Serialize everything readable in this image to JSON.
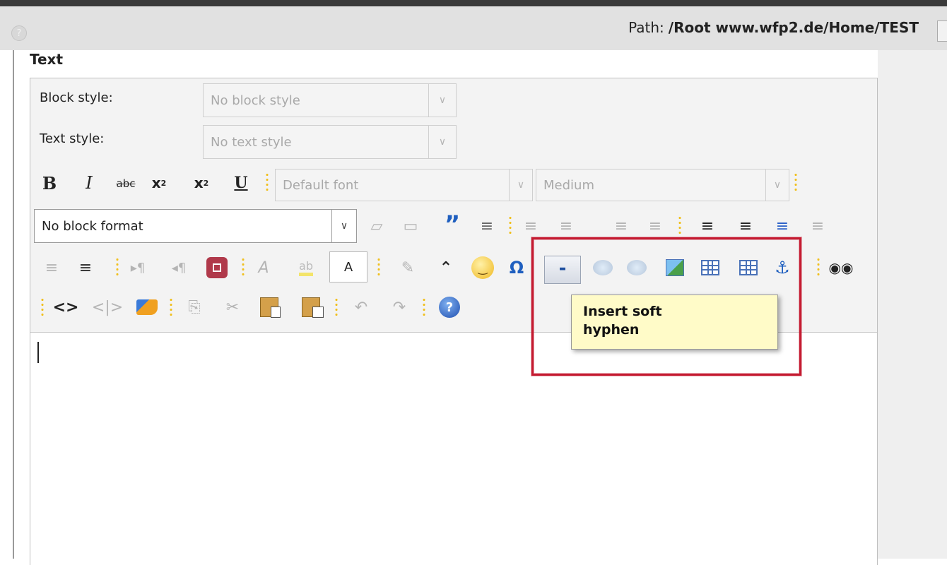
{
  "path": {
    "label": "Path:",
    "value": "/Root www.wfp2.de/Home/TEST"
  },
  "section_title": "Text",
  "block_style": {
    "label": "Block style:",
    "value": "No block style"
  },
  "text_style": {
    "label": "Text style:",
    "value": "No text style"
  },
  "font": {
    "value": "Default font"
  },
  "size": {
    "value": "Medium"
  },
  "block_format": {
    "value": "No block format"
  },
  "font_color_label": "A",
  "tooltip": {
    "line1": "Insert soft",
    "line2": "hyphen"
  },
  "colors": {
    "highlight": "#c41a30",
    "tooltip_bg": "#fffbc8",
    "path_bar": "#e1e1e1"
  },
  "icons": {
    "row1": [
      "bold-icon",
      "italic-icon",
      "strikethrough-icon",
      "subscript-icon",
      "superscript-icon",
      "underline-icon"
    ],
    "row2": [
      "insert-div-icon",
      "comment-icon",
      "blockquote-icon",
      "justify-icon",
      "align-left-icon",
      "align-center-icon",
      "align-right-icon",
      "align-full-icon",
      "numbered-list-icon",
      "bullet-list-icon",
      "indent-icon",
      "outdent-icon"
    ],
    "row3": [
      "decrease-indent-icon",
      "increase-indent-icon",
      "ltr-icon",
      "rtl-icon",
      "show-blocks-icon",
      "remove-format-icon",
      "text-highlight-icon",
      "font-color-icon",
      "pencil-icon",
      "chevrons-icon",
      "smiley-icon",
      "omega-icon",
      "soft-hyphen-icon",
      "insert-link-icon",
      "remove-link-icon",
      "insert-image-icon",
      "insert-table-icon",
      "table-properties-icon",
      "anchor-icon",
      "find-icon"
    ],
    "row4": [
      "source-code-icon",
      "html-tags-icon",
      "cleanup-broom-icon",
      "copy-icon",
      "cut-icon",
      "paste-icon",
      "paste-word-icon",
      "undo-icon",
      "redo-icon",
      "help-icon"
    ]
  }
}
